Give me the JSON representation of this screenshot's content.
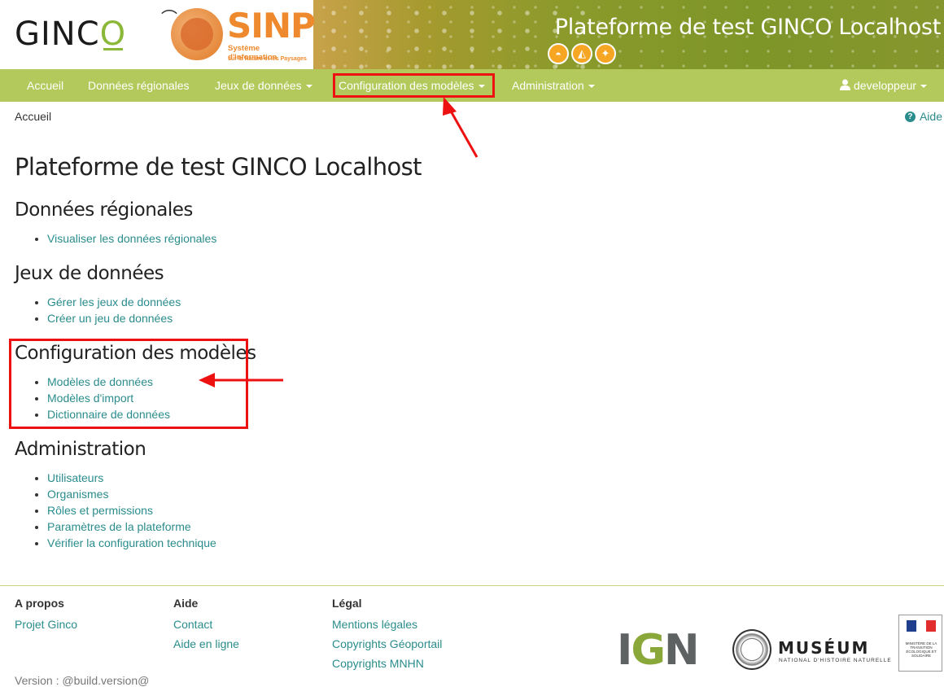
{
  "header": {
    "logo_text": "GINCO",
    "sinp_title": "SINP",
    "sinp_subtitle": "Système d'Information",
    "sinp_subtitle2": "sur la Nature et les Paysages",
    "platform_title": "Plateforme de test GINCO Localhost"
  },
  "navbar": {
    "items": [
      {
        "label": "Accueil"
      },
      {
        "label": "Données régionales"
      },
      {
        "label": "Jeux de données"
      },
      {
        "label": "Configuration des modèles"
      },
      {
        "label": "Administration"
      }
    ],
    "user_label": "developpeur"
  },
  "breadcrumb": "Accueil",
  "help_label": "Aide",
  "main": {
    "title": "Plateforme de test GINCO Localhost",
    "sections": [
      {
        "title": "Données régionales",
        "links": [
          "Visualiser les données régionales"
        ]
      },
      {
        "title": "Jeux de données",
        "links": [
          "Gérer les jeux de données",
          "Créer un jeu de données"
        ]
      },
      {
        "title": "Configuration des modèles",
        "links": [
          "Modèles de données",
          "Modèles d'import",
          "Dictionnaire de données"
        ]
      },
      {
        "title": "Administration",
        "links": [
          "Utilisateurs",
          "Organismes",
          "Rôles et permissions",
          "Paramètres de la plateforme",
          "Vérifier la configuration technique"
        ]
      }
    ]
  },
  "footer": {
    "cols": [
      {
        "title": "A propos",
        "links": [
          "Projet Ginco"
        ]
      },
      {
        "title": "Aide",
        "links": [
          "Contact",
          "Aide en ligne"
        ]
      },
      {
        "title": "Légal",
        "links": [
          "Mentions légales",
          "Copyrights Géoportail",
          "Copyrights MNHN"
        ]
      }
    ],
    "version": "Version : @build.version@",
    "partners": {
      "ign": "IGN",
      "museum": "MUSÉUM",
      "museum_sub": "NATIONAL D'HISTOIRE NATURELLE",
      "ministere": "MINISTÈRE DE LA TRANSITION ÉCOLOGIQUE ET SOLIDAIRE"
    }
  },
  "colors": {
    "navbar": "#b4c95b",
    "link": "#2a8c8c",
    "highlight": "#e11111"
  }
}
